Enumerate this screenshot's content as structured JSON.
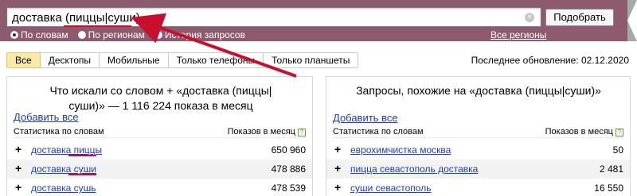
{
  "search": {
    "query": "доставка (пиццы|суши)",
    "submit_label": "Подобрать",
    "modes": [
      {
        "label": "По словам",
        "checked": true
      },
      {
        "label": "По регионам",
        "checked": false
      },
      {
        "label": "История запросов",
        "checked": false
      }
    ],
    "regions_link": "Все регионы"
  },
  "device_tabs": [
    "Все",
    "Десктопы",
    "Мобильные",
    "Только телефоны",
    "Только планшеты"
  ],
  "last_update": "Последнее обновление: 02.12.2020",
  "left_panel": {
    "title_line1": "Что искали со словом  + «доставка (пиццы|",
    "title_line2": "суши)» — 1 116 224 показа в месяц",
    "add_all": "Добавить все",
    "col_words": "Статистика по словам",
    "col_count": "Показов в месяц",
    "rows": [
      {
        "phrase": "доставка пиццы",
        "count": "650 960"
      },
      {
        "phrase": "доставка суши",
        "count": "478 886"
      },
      {
        "phrase": "доставка сушь",
        "count": "478 539"
      }
    ]
  },
  "right_panel": {
    "title": "Запросы, похожие на «доставка (пиццы|суши)»",
    "add_all": "Добавить все",
    "col_words": "Статистика по словам",
    "col_count": "Показов в месяц",
    "rows": [
      {
        "phrase": "еврохимчистка москва",
        "count": "50"
      },
      {
        "phrase": "пицца севастополь доставка",
        "count": "2 481"
      },
      {
        "phrase": "суши севастополь",
        "count": "16 550"
      }
    ]
  },
  "colors": {
    "header_band": "#8e5a6e",
    "active_tab": "#fbe9a8",
    "link": "#1a3dc1",
    "annotation": "#c8102e"
  }
}
